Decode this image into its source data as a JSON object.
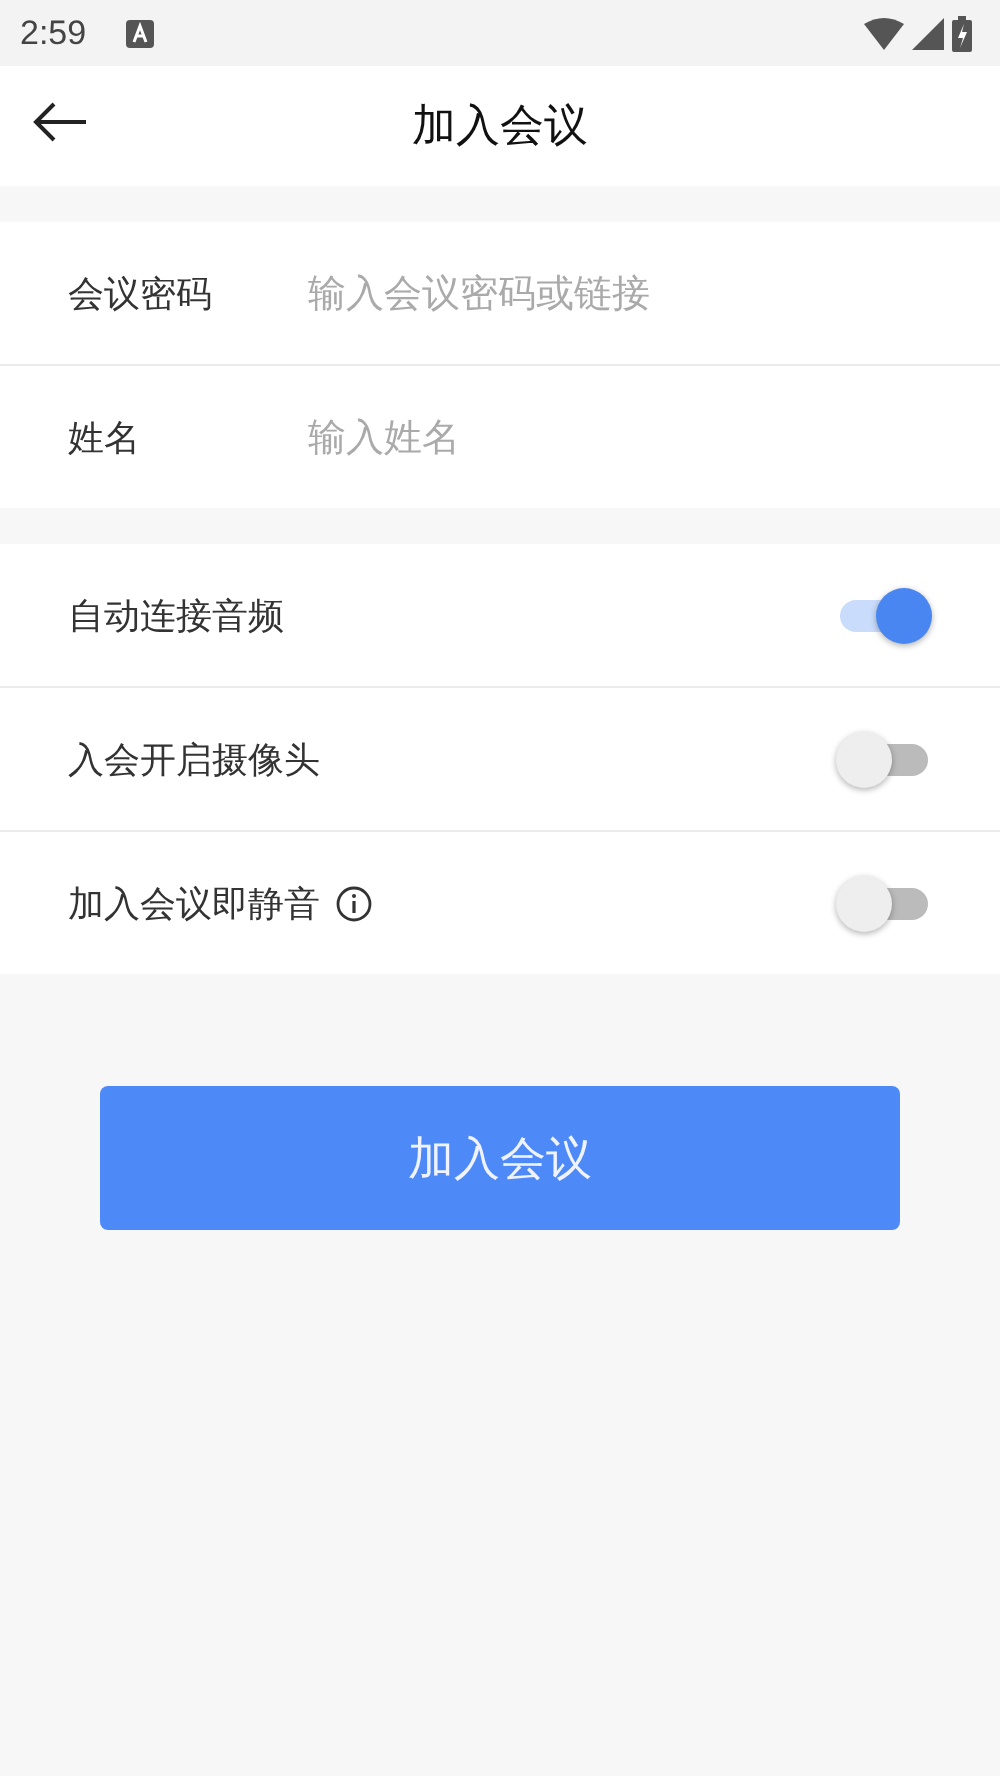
{
  "status_bar": {
    "time": "2:59"
  },
  "header": {
    "title": "加入会议"
  },
  "fields": [
    {
      "label": "会议密码",
      "placeholder": "输入会议密码或链接"
    },
    {
      "label": "姓名",
      "placeholder": "输入姓名"
    }
  ],
  "options": [
    {
      "label": "自动连接音频",
      "on": true,
      "info_icon": false
    },
    {
      "label": "入会开启摄像头",
      "on": false,
      "info_icon": false
    },
    {
      "label": "加入会议即静音",
      "on": false,
      "info_icon": true
    }
  ],
  "join_button": "加入会议"
}
